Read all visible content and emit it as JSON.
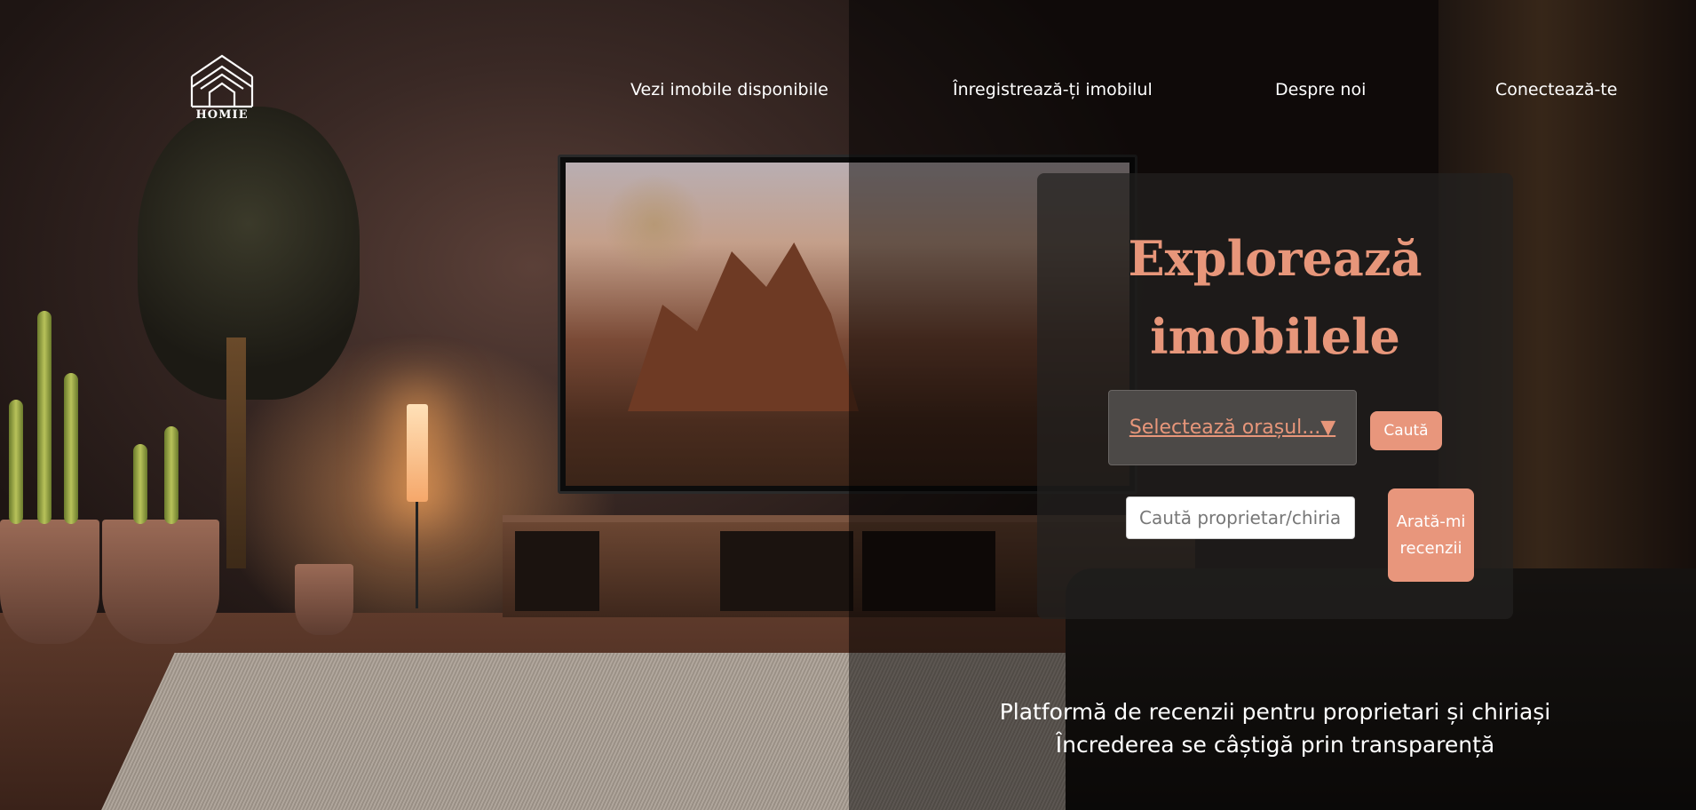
{
  "brand": {
    "logo_text": "HOMIE",
    "accent_color": "#e8967c",
    "icon": "house-logo-icon"
  },
  "nav": {
    "items": [
      {
        "label": "Vezi imobile disponibile"
      },
      {
        "label": "Înregistrează-ți imobilul"
      },
      {
        "label": "Despre noi"
      },
      {
        "label": "Conectează-te"
      }
    ]
  },
  "explore": {
    "title_line1": "Explorează",
    "title_line2": "imobilele",
    "city_select": "Selectează orașul...▼",
    "search_button": "Caută",
    "owner_search_placeholder": "Caută proprietar/chiriaș",
    "owner_search_value": "",
    "reviews_button": "Arată-mi recenzii"
  },
  "tagline": {
    "line1": "Platformă de recenzii pentru proprietari și chiriași",
    "line2": "Încrederea se câștigă prin transparență"
  }
}
